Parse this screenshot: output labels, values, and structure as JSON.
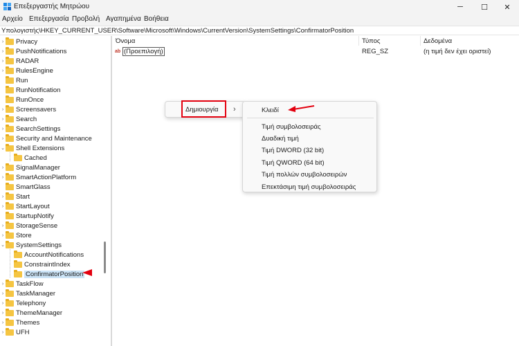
{
  "window": {
    "title": "Επεξεργαστής Μητρώου",
    "icon": "registry-editor-icon",
    "controls": {
      "minimize": "─",
      "maximize": "☐",
      "close": "✕"
    }
  },
  "menu": {
    "items": [
      "Αρχείο",
      "Επεξεργασία",
      "Προβολή",
      "Αγαπημένα",
      "Βοήθεια"
    ]
  },
  "address": {
    "path": "Υπολογιστής\\HKEY_CURRENT_USER\\Software\\Microsoft\\Windows\\CurrentVersion\\SystemSettings\\ConfirmatorPosition"
  },
  "tree": {
    "items": [
      {
        "label": "Privacy",
        "chevron": "›"
      },
      {
        "label": "PushNotifications",
        "chevron": "›"
      },
      {
        "label": "RADAR",
        "chevron": "›"
      },
      {
        "label": "RulesEngine",
        "chevron": "›"
      },
      {
        "label": "Run",
        "chevron": ""
      },
      {
        "label": "RunNotification",
        "chevron": ""
      },
      {
        "label": "RunOnce",
        "chevron": ""
      },
      {
        "label": "Screensavers",
        "chevron": "›"
      },
      {
        "label": "Search",
        "chevron": "›"
      },
      {
        "label": "SearchSettings",
        "chevron": "›"
      },
      {
        "label": "Security and Maintenance",
        "chevron": "›"
      },
      {
        "label": "Shell Extensions",
        "chevron": "⌄"
      },
      {
        "label": "Cached",
        "chevron": ""
      },
      {
        "label": "SignalManager",
        "chevron": "›"
      },
      {
        "label": "SmartActionPlatform",
        "chevron": "›"
      },
      {
        "label": "SmartGlass",
        "chevron": ""
      },
      {
        "label": "Start",
        "chevron": "›"
      },
      {
        "label": "StartLayout",
        "chevron": "›"
      },
      {
        "label": "StartupNotify",
        "chevron": ""
      },
      {
        "label": "StorageSense",
        "chevron": "›"
      },
      {
        "label": "Store",
        "chevron": "›"
      },
      {
        "label": "SystemSettings",
        "chevron": "⌄"
      },
      {
        "label": "AccountNotifications",
        "chevron": ""
      },
      {
        "label": "ConstraintIndex",
        "chevron": ""
      },
      {
        "label": "ConfirmatorPosition",
        "chevron": ""
      },
      {
        "label": "TaskFlow",
        "chevron": "›"
      },
      {
        "label": "TaskManager",
        "chevron": "›"
      },
      {
        "label": "Telephony",
        "chevron": "›"
      },
      {
        "label": "ThemeManager",
        "chevron": "›"
      },
      {
        "label": "Themes",
        "chevron": "›"
      },
      {
        "label": "UFH",
        "chevron": "›"
      }
    ]
  },
  "list": {
    "columns": [
      "Όνομα",
      "Τύπος",
      "Δεδομένα"
    ],
    "rows": [
      {
        "name": "(Προεπιλογή)",
        "type": "REG_SZ",
        "data": "(η τιμή δεν έχει οριστεί)",
        "icon": "string-value-icon"
      }
    ]
  },
  "context_menu": {
    "new_label": "Δημιουργία",
    "submenu_chevron": "›",
    "submenu": {
      "key": "Κλειδί",
      "items": [
        "Τιμή συμβολοσειράς",
        "Δυαδική τιμή",
        "Τιμή DWORD (32 bit)",
        "Τιμή QWORD (64 bit)",
        "Τιμή πολλών συμβολοσειρών",
        "Επεκτάσιμη τιμή συμβολοσειράς"
      ]
    }
  },
  "colors": {
    "annotation_red": "#e3000f",
    "folder": "#f5c542",
    "selection": "#cce4f7"
  }
}
